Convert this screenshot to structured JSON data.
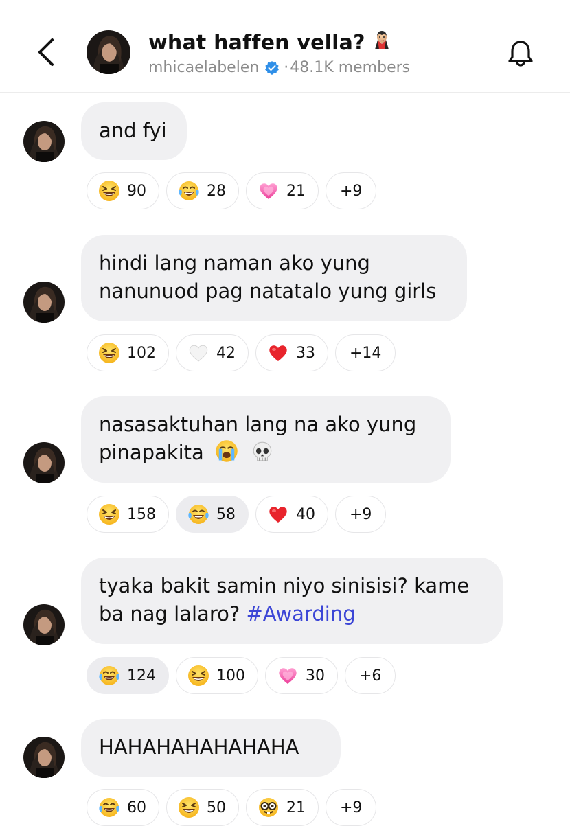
{
  "header": {
    "title": "what haffen vella?",
    "title_emoji": "vampire-emoji",
    "username": "mhicaelabelen",
    "separator": "·",
    "members": "48.1K members",
    "icons": [
      "back-chevron-icon",
      "verified-badge-icon",
      "bell-icon"
    ]
  },
  "messages": [
    {
      "text": "and fyi",
      "reactions": [
        {
          "emoji": "grinning-squint-emoji",
          "count": "90"
        },
        {
          "emoji": "tears-of-joy-emoji",
          "count": "28"
        },
        {
          "emoji": "pink-heart-emoji",
          "count": "21"
        }
      ],
      "more": "+9"
    },
    {
      "line1": "hindi lang naman ako yung",
      "line2": "nanunuod pag natatalo yung girls",
      "reactions": [
        {
          "emoji": "grinning-squint-emoji",
          "count": "102"
        },
        {
          "emoji": "white-heart-emoji",
          "count": "42"
        },
        {
          "emoji": "red-heart-emoji",
          "count": "33"
        }
      ],
      "more": "+14"
    },
    {
      "line1": "nasasaktuhan lang na ako yung",
      "line2": "pinapakita",
      "trailing_emojis": [
        "loudly-crying-emoji",
        "skull-emoji"
      ],
      "reactions": [
        {
          "emoji": "grinning-squint-emoji",
          "count": "158"
        },
        {
          "emoji": "tears-of-joy-emoji",
          "count": "58",
          "selected": true
        },
        {
          "emoji": "red-heart-emoji",
          "count": "40"
        }
      ],
      "more": "+9"
    },
    {
      "line1": "tyaka bakit samin niyo sinisisi? kame",
      "line2": "ba nag lalaro?",
      "hashtag": "#Awarding",
      "reactions": [
        {
          "emoji": "tears-of-joy-emoji",
          "count": "124",
          "selected": true
        },
        {
          "emoji": "grinning-squint-emoji",
          "count": "100"
        },
        {
          "emoji": "pink-heart-emoji",
          "count": "30"
        }
      ],
      "more": "+6"
    },
    {
      "text": "HAHAHAHAHAHAHA",
      "reactions": [
        {
          "emoji": "tears-of-joy-emoji",
          "count": "60"
        },
        {
          "emoji": "grinning-squint-emoji",
          "count": "50"
        },
        {
          "emoji": "nerd-face-emoji",
          "count": "21"
        }
      ],
      "more": "+9"
    }
  ],
  "colors": {
    "bubble": "#f0f0f2",
    "hashtag": "#3c46d6",
    "verified": "#2f8fe8",
    "secondary_text": "#8b8b8b"
  }
}
